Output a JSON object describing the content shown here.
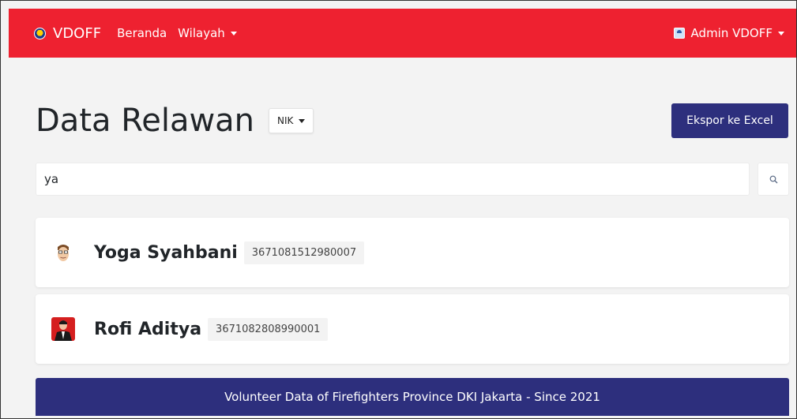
{
  "navbar": {
    "brand": "VDOFF",
    "links": [
      {
        "label": "Beranda"
      },
      {
        "label": "Wilayah"
      }
    ],
    "user": "Admin VDOFF",
    "brand_color": "#ee2130"
  },
  "header": {
    "title": "Data Relawan",
    "filter": "NIK",
    "export_label": "Ekspor ke Excel"
  },
  "search": {
    "value": "ya",
    "placeholder": ""
  },
  "results": [
    {
      "name": "Yoga Syahbani",
      "nik": "3671081512980007",
      "avatar": "cartoon-face-avatar"
    },
    {
      "name": "Rofi Aditya",
      "nik": "3671082808990001",
      "avatar": "photo-avatar"
    }
  ],
  "footer": {
    "text": "Volunteer Data of Firefighters Province DKI Jakarta - Since 2021",
    "color": "#2d2f7d"
  }
}
